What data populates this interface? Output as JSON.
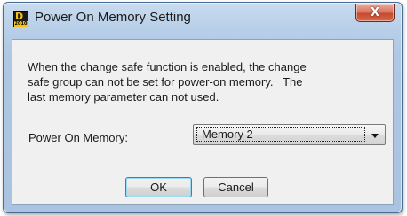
{
  "window": {
    "title": "Power On Memory Setting",
    "icon": "app-d-logo-icon",
    "close_glyph": "X"
  },
  "message": {
    "lines": [
      "When the change safe function is enabled, the change",
      "safe group can not be set for power-on memory.   The",
      "last memory parameter can not used."
    ]
  },
  "power_on_memory": {
    "label": "Power On Memory:",
    "selected": "Memory 2"
  },
  "buttons": {
    "ok": "OK",
    "cancel": "Cancel"
  }
}
